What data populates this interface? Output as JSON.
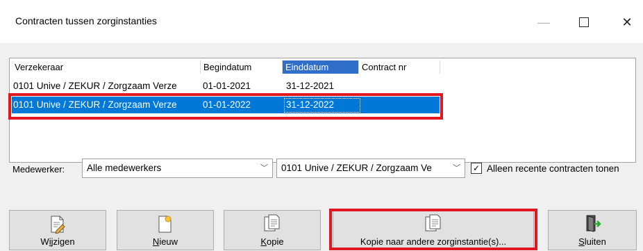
{
  "window": {
    "title": "Contracten tussen zorginstanties"
  },
  "table": {
    "headers": [
      "Verzekeraar",
      "Begindatum",
      "Einddatum",
      "Contract nr"
    ],
    "rows": [
      [
        "0101 Unive / ZEKUR / Zorgzaam Verze",
        "01-01-2021",
        "31-12-2021",
        ""
      ],
      [
        "0101 Unive / ZEKUR / Zorgzaam Verze",
        "01-01-2022",
        "31-12-2022",
        ""
      ]
    ]
  },
  "filter": {
    "medewerker_label": "Medewerker:",
    "medewerker_value": "Alle medewerkers",
    "verzekeraar_value": "0101 Unive / ZEKUR / Zorgzaam Ve",
    "recent_label": "Alleen recente contracten tonen",
    "recent_checked": true
  },
  "buttons": {
    "wijzigen_pre": "W",
    "wijzigen_u": "i",
    "wijzigen_post": "jzigen",
    "nieuw_u": "N",
    "nieuw_post": "ieuw",
    "kopie_u": "K",
    "kopie_post": "opie",
    "kopie_andere": "Kopie naar andere zorginstantie(s)...",
    "sluiten_u": "S",
    "sluiten_post": "luiten"
  },
  "colors": {
    "selection": "#0078d7",
    "highlight": "#e3171f"
  }
}
